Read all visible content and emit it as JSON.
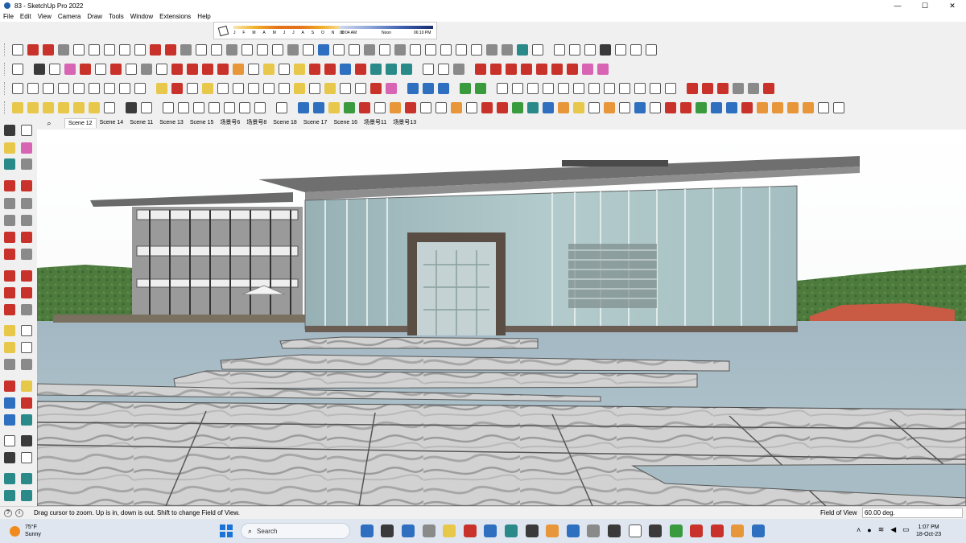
{
  "window": {
    "title": "83 - SketchUp Pro 2022",
    "controls": {
      "minimize": "—",
      "maximize": "☐",
      "close": "✕"
    }
  },
  "menu": [
    "File",
    "Edit",
    "View",
    "Camera",
    "Draw",
    "Tools",
    "Window",
    "Extensions",
    "Help"
  ],
  "shadows": {
    "months": [
      "J",
      "F",
      "M",
      "A",
      "M",
      "J",
      "J",
      "A",
      "S",
      "O",
      "N",
      "D"
    ],
    "time_start": "06:04 AM",
    "time_mid": "Noon",
    "time_end": "06:10 PM"
  },
  "scenes": {
    "search_icon": "magnifier-icon",
    "tabs": [
      "Scene 12",
      "Scene 14",
      "Scene 11",
      "Scene 13",
      "Scene 15",
      "场景号6",
      "场景号8",
      "Scene 18",
      "Scene 17",
      "Scene 16",
      "场景号11",
      "场景号13"
    ],
    "active_index": 0
  },
  "status": {
    "hint": "Drag cursor to zoom.  Up is in, down is out. Shift to change Field of View.",
    "vcb_label": "Field of View",
    "vcb_value": "60.00 deg."
  },
  "taskbar": {
    "weather_temp": "75°F",
    "weather_desc": "Sunny",
    "search_label": "Search",
    "time": "1:07 PM",
    "date": "18-Oct-23",
    "tray_icons": [
      "chevron-up-icon",
      "wifi-icon",
      "speaker-icon",
      "battery-icon"
    ]
  },
  "colors": {
    "sky": "#ffffff",
    "hills": "#4a7a3a",
    "glass": "#a9c3c6",
    "roof": "#8c8c8c",
    "water": "#a9c0c9",
    "marble": "#c9c9c9",
    "frame": "#5a4e44"
  }
}
